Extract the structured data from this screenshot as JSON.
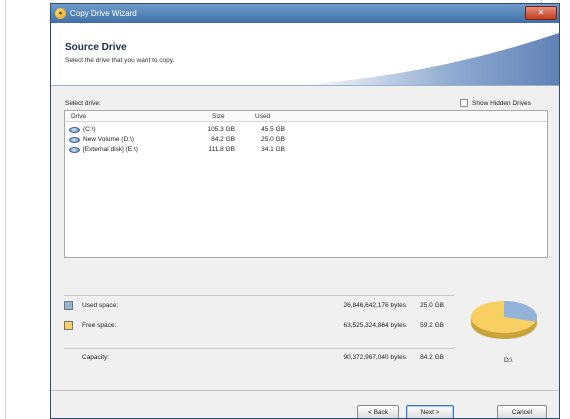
{
  "window": {
    "title": "Copy Drive Wizard",
    "close_glyph": "✕"
  },
  "header": {
    "title": "Source Drive",
    "subtitle": "Select the drive that you want to copy."
  },
  "select_label": "Select drive:",
  "show_hidden_label": "Show Hidden Drives",
  "list": {
    "columns": [
      "Drive",
      "Size",
      "Used"
    ],
    "rows": [
      {
        "drive": "(C:\\)",
        "size": "105.3 GB",
        "used": "45.5 GB"
      },
      {
        "drive": "New Volume (D:\\)",
        "size": "84.2 GB",
        "used": "25.0 GB"
      },
      {
        "drive": "[External disk] (E:\\)",
        "size": "111.8 GB",
        "used": "34.1 GB"
      }
    ]
  },
  "legend": {
    "used": {
      "label": "Used space:",
      "bytes": "26,846,642,176 bytes",
      "gb": "25.0 GB",
      "color": "#94b3d9"
    },
    "free": {
      "label": "Free space:",
      "bytes": "63,525,324,864 bytes",
      "gb": "59.2 GB",
      "color": "#f7cf63"
    },
    "capacity": {
      "label": "Capacity:",
      "bytes": "90,372,967,040 bytes",
      "gb": "84.2 GB"
    }
  },
  "pie": {
    "drive_label": "D:\\",
    "used_fraction": 0.297
  },
  "buttons": {
    "back": "< Back",
    "next": "Next >",
    "cancel": "Cancel"
  }
}
